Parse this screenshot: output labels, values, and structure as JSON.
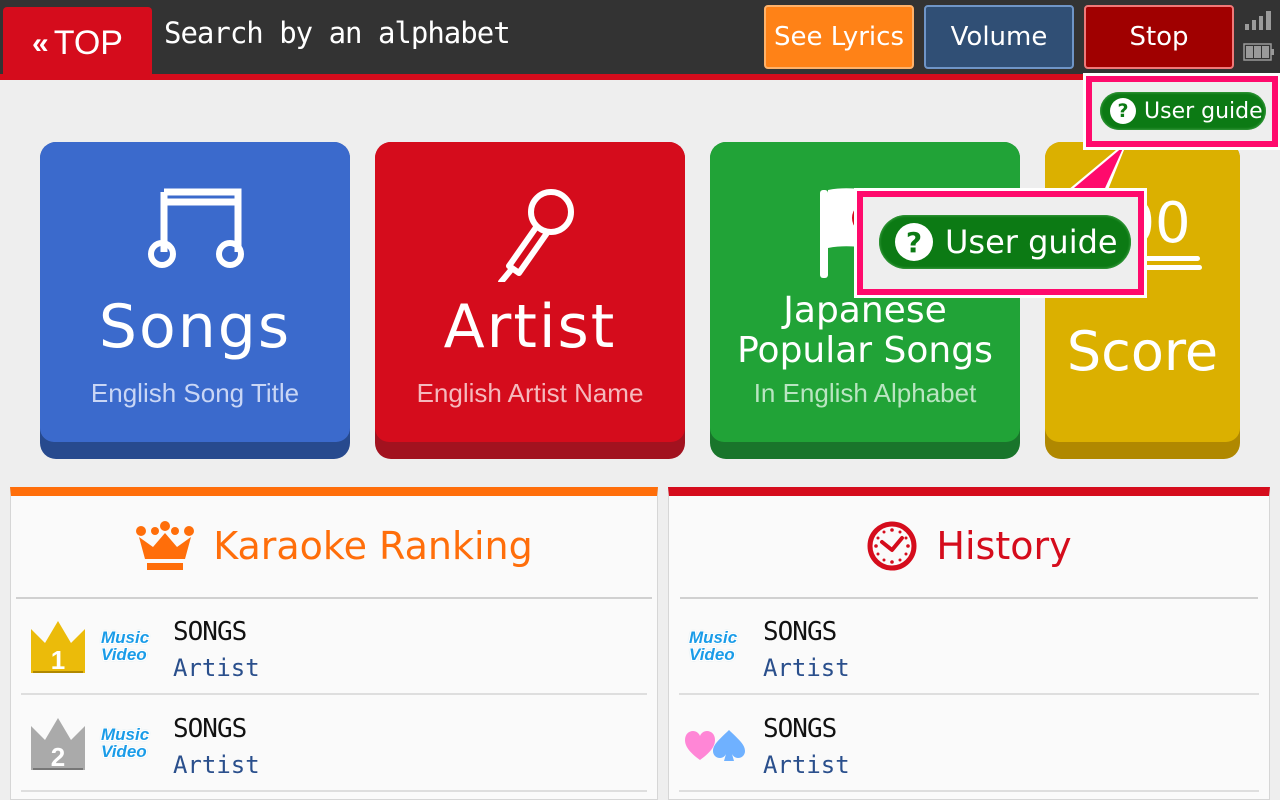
{
  "header": {
    "top_button": {
      "chevron": "«",
      "label": "TOP"
    },
    "title": "Search by an alphabet",
    "buttons": {
      "lyrics": "See Lyrics",
      "volume": "Volume",
      "stop": "Stop"
    },
    "status_icons": [
      "signal-icon",
      "battery-icon"
    ]
  },
  "user_guide": {
    "label": "User guide",
    "icon": "question-icon",
    "callout_label": "User guide"
  },
  "tiles": [
    {
      "title": "Songs",
      "subtitle": "English Song Title",
      "icon": "music-note-icon",
      "color": "#3b6acc"
    },
    {
      "title": "Artist",
      "subtitle": "English Artist Name",
      "icon": "microphone-icon",
      "color": "#d50c1c"
    },
    {
      "title_line1": "Japanese",
      "title_line2": "Popular Songs",
      "subtitle": "In English Alphabet",
      "icon": "japan-flag-icon",
      "color": "#21a337"
    },
    {
      "title": "Score",
      "icon": "score-icon",
      "icon_text": "00",
      "color": "#dbb000"
    }
  ],
  "ranking": {
    "title": "Karaoke Ranking",
    "icon": "crown-icon",
    "accent": "#ff6e0a",
    "rows": [
      {
        "rank": "1",
        "badge": "Music\nVideo",
        "badge_line1": "Music",
        "badge_line2": "Video",
        "song": "SONGS",
        "artist": "Artist"
      },
      {
        "rank": "2",
        "badge_line1": "Music",
        "badge_line2": "Video",
        "song": "SONGS",
        "artist": "Artist"
      }
    ]
  },
  "history": {
    "title": "History",
    "icon": "clock-icon",
    "accent": "#d50c1c",
    "rows": [
      {
        "badge_line1": "Music",
        "badge_line2": "Video",
        "song": "SONGS",
        "artist": "Artist"
      },
      {
        "badge": "duet-hearts-spades-icon",
        "song": "SONGS",
        "artist": "Artist"
      }
    ]
  }
}
